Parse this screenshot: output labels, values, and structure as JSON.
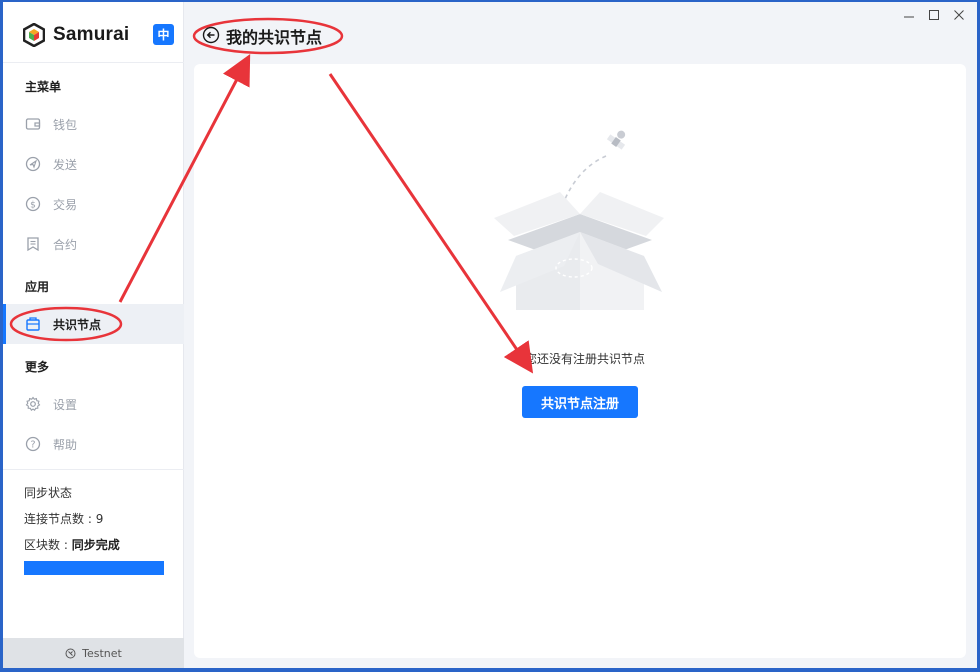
{
  "app": {
    "brand": "Samurai",
    "lang_button": "中"
  },
  "sidebar": {
    "sections": {
      "main": "主菜单",
      "apps": "应用",
      "more": "更多"
    },
    "items": [
      {
        "label": "钱包",
        "icon": "wallet-icon"
      },
      {
        "label": "发送",
        "icon": "send-icon"
      },
      {
        "label": "交易",
        "icon": "transaction-icon"
      },
      {
        "label": "合约",
        "icon": "contract-icon"
      },
      {
        "label": "共识节点",
        "icon": "consensus-node-icon"
      },
      {
        "label": "设置",
        "icon": "gear-icon"
      },
      {
        "label": "帮助",
        "icon": "help-icon"
      }
    ],
    "sync": {
      "status_label": "同步状态",
      "nodes_label": "连接节点数 : ",
      "nodes_value": "9",
      "blocks_label": "区块数 : ",
      "blocks_value": "同步完成",
      "progress": 1.0
    },
    "network": "Testnet"
  },
  "header": {
    "title": "我的共识节点"
  },
  "main": {
    "empty_text": "您还没有注册共识节点",
    "register_button": "共识节点注册"
  },
  "colors": {
    "accent": "#1677ff",
    "annotation": "#e8343a"
  }
}
